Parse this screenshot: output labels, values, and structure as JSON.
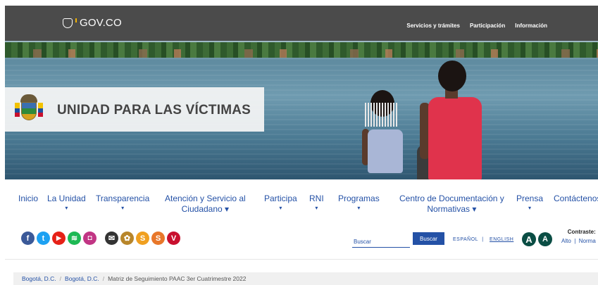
{
  "gov": {
    "logo_text": "GOV.CO",
    "links": [
      "Servicios y trámites",
      "Participación",
      "Información"
    ]
  },
  "hero": {
    "title": "UNIDAD PARA LAS VÍCTIMAS"
  },
  "nav": {
    "items": [
      {
        "line1": "Inicio",
        "line2": "",
        "caret": false
      },
      {
        "line1": "La Unidad",
        "line2": "",
        "caret": true
      },
      {
        "line1": "Transparencia",
        "line2": "",
        "caret": true
      },
      {
        "line1": "Atención y Servicio al",
        "line2": "Ciudadano",
        "caret": true
      },
      {
        "line1": "Participa",
        "line2": "",
        "caret": true
      },
      {
        "line1": "RNI",
        "line2": "",
        "caret": true
      },
      {
        "line1": "Programas",
        "line2": "",
        "caret": true
      },
      {
        "line1": "Centro de Documentación y",
        "line2": "Normativas",
        "caret": true
      },
      {
        "line1": "Prensa",
        "line2": "",
        "caret": true
      },
      {
        "line1": "Contáctenos",
        "line2": "",
        "caret": false
      }
    ],
    "caret_glyph": "▾"
  },
  "social": [
    {
      "icon": "facebook-icon",
      "glyph": "f",
      "color": "#3b5998"
    },
    {
      "icon": "twitter-icon",
      "glyph": "t",
      "color": "#1da1f2"
    },
    {
      "icon": "youtube-icon",
      "glyph": "▶",
      "color": "#e62117"
    },
    {
      "icon": "spotify-icon",
      "glyph": "≋",
      "color": "#1db954"
    },
    {
      "icon": "instagram-icon",
      "glyph": "◘",
      "color": "#c13584"
    },
    {
      "icon": "mail-icon",
      "glyph": "✉",
      "color": "#333333"
    },
    {
      "icon": "emblem-icon",
      "glyph": "✿",
      "color": "#b8862a"
    },
    {
      "icon": "s-orange-icon",
      "glyph": "S",
      "color": "#f0a020"
    },
    {
      "icon": "s-orange2-icon",
      "glyph": "S",
      "color": "#e8772a"
    },
    {
      "icon": "v-red-icon",
      "glyph": "V",
      "color": "#c8102e"
    }
  ],
  "search": {
    "placeholder": "Buscar",
    "button": "Buscar"
  },
  "language": {
    "es": "ESPAÑOL",
    "sep": "|",
    "en": "ENGLISH"
  },
  "accessibility": {
    "a1": "A",
    "a2": "A",
    "contrast_label": "Contraste:",
    "alto": "Alto",
    "sep": "|",
    "normal": "Norma"
  },
  "breadcrumb": {
    "items": [
      "Bogotá, D.C.",
      "Bogotá, D.C."
    ],
    "sep": "/",
    "current": "Matriz de Seguimiento PAAC 3er Cuatrimestre 2022"
  }
}
